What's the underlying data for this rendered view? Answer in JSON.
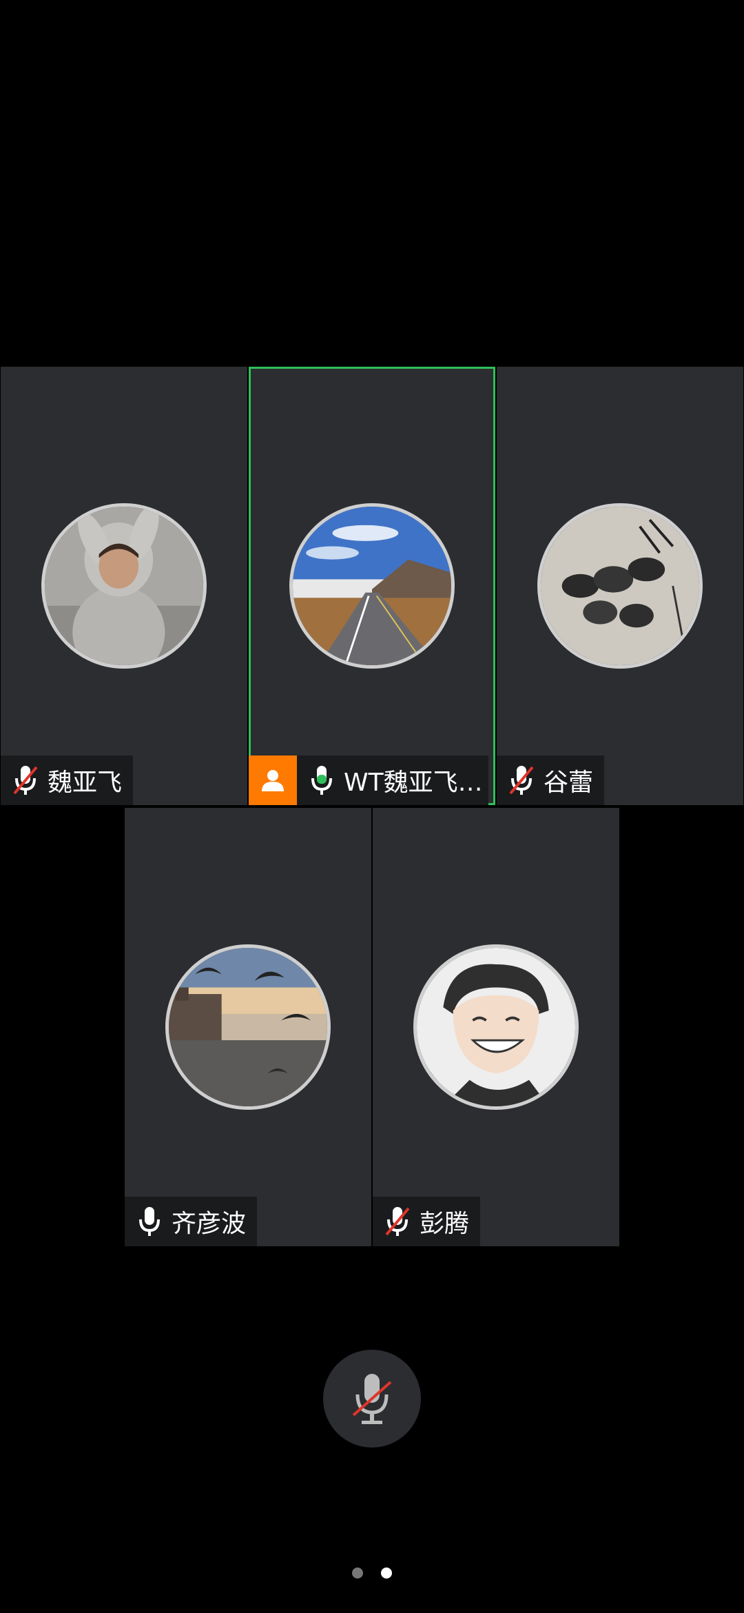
{
  "participants": [
    {
      "name": "魏亚飞",
      "mic": "muted",
      "avatar": "child-in-hoodie-photo",
      "host": false,
      "active": false
    },
    {
      "name": "WT魏亚飞…",
      "mic": "speaking",
      "avatar": "mountain-road-photo",
      "host": true,
      "active": true
    },
    {
      "name": "谷蕾",
      "mic": "muted",
      "avatar": "ink-painting-photo",
      "host": false,
      "active": false
    },
    {
      "name": "齐彦波",
      "mic": "on",
      "avatar": "seagulls-city-photo",
      "host": false,
      "active": false
    },
    {
      "name": "彭腾",
      "mic": "muted",
      "avatar": "smiling-cartoon-man",
      "host": false,
      "active": false
    }
  ],
  "controls": {
    "self_mic": "muted"
  },
  "pagination": {
    "total": 2,
    "current": 2
  },
  "colors": {
    "active_border": "#2fbf5a",
    "host_badge": "#ff7a00",
    "speaking_mic": "#2fbf5a",
    "muted_slash": "#e0342b",
    "tile_bg": "#2b2d30"
  }
}
